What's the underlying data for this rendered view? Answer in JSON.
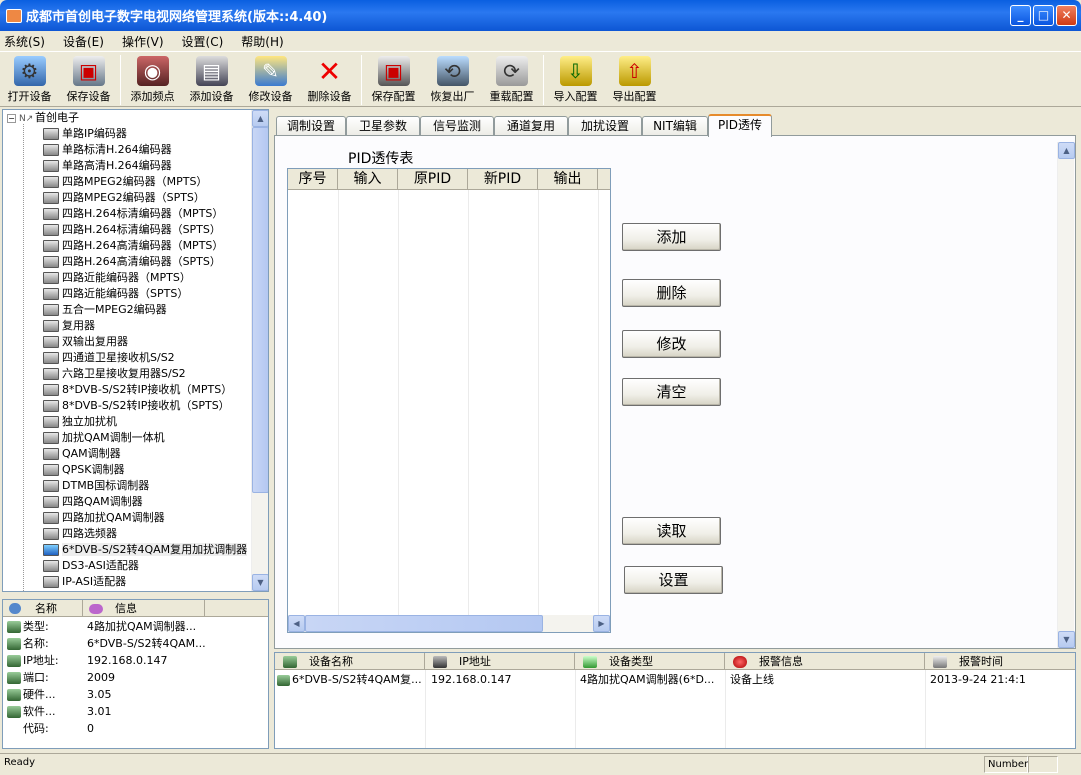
{
  "window": {
    "title": "成都市首创电子数字电视网络管理系统(版本::4.40)"
  },
  "menu": [
    "系统(S)",
    "设备(E)",
    "操作(V)",
    "设置(C)",
    "帮助(H)"
  ],
  "toolbar": [
    {
      "label": "打开设备",
      "icon": "open-device-icon"
    },
    {
      "label": "保存设备",
      "icon": "save-device-icon"
    },
    {
      "label": "添加频点",
      "icon": "add-frequency-icon"
    },
    {
      "label": "添加设备",
      "icon": "add-device-icon"
    },
    {
      "label": "修改设备",
      "icon": "edit-device-icon"
    },
    {
      "label": "删除设备",
      "icon": "delete-device-icon"
    },
    {
      "label": "保存配置",
      "icon": "save-config-icon"
    },
    {
      "label": "恢复出厂",
      "icon": "factory-reset-icon"
    },
    {
      "label": "重载配置",
      "icon": "reload-config-icon"
    },
    {
      "label": "导入配置",
      "icon": "import-config-icon"
    },
    {
      "label": "导出配置",
      "icon": "export-config-icon"
    }
  ],
  "tree": {
    "root": "首创电子",
    "items": [
      "单路IP编码器",
      "单路标清H.264编码器",
      "单路高清H.264编码器",
      "四路MPEG2编码器（MPTS）",
      "四路MPEG2编码器（SPTS）",
      "四路H.264标清编码器（MPTS）",
      "四路H.264标清编码器（SPTS）",
      "四路H.264高清编码器（MPTS）",
      "四路H.264高清编码器（SPTS）",
      "四路近能编码器（MPTS）",
      "四路近能编码器（SPTS）",
      "五合一MPEG2编码器",
      "复用器",
      "双输出复用器",
      "四通道卫星接收机S/S2",
      "六路卫星接收复用器S/S2",
      "8*DVB-S/S2转IP接收机（MPTS）",
      "8*DVB-S/S2转IP接收机（SPTS）",
      "独立加扰机",
      "加扰QAM调制一体机",
      "QAM调制器",
      "QPSK调制器",
      "DTMB国标调制器",
      "四路QAM调制器",
      "四路加扰QAM调制器",
      "四路选频器",
      "6*DVB-S/S2转4QAM复用加扰调制器",
      "DS3-ASI适配器",
      "IP-ASI适配器"
    ],
    "selected_index": 26
  },
  "info": {
    "col_name": "名称",
    "col_info": "信息",
    "rows": [
      {
        "key": "类型:",
        "value": "4路加扰QAM调制器..."
      },
      {
        "key": "名称:",
        "value": "6*DVB-S/S2转4QAM..."
      },
      {
        "key": "IP地址:",
        "value": "192.168.0.147"
      },
      {
        "key": "端口:",
        "value": "2009"
      },
      {
        "key": "硬件...",
        "value": "3.05"
      },
      {
        "key": "软件...",
        "value": "3.01"
      },
      {
        "key": "代码:",
        "value": "0"
      }
    ]
  },
  "tabs": [
    "调制设置",
    "卫星参数",
    "信号监测",
    "通道复用",
    "加扰设置",
    "NIT编辑",
    "PID透传"
  ],
  "active_tab": 6,
  "pid": {
    "title": "PID透传表",
    "columns": [
      "序号",
      "输入",
      "原PID",
      "新PID",
      "输出"
    ],
    "buttons": {
      "add": "添加",
      "delete": "删除",
      "modify": "修改",
      "clear": "清空",
      "read": "读取",
      "set": "设置"
    }
  },
  "alarm": {
    "columns": [
      "设备名称",
      "IP地址",
      "设备类型",
      "报警信息",
      "报警时间"
    ],
    "rows": [
      {
        "name": "6*DVB-S/S2转4QAM复...",
        "ip": "192.168.0.147",
        "type": "4路加扰QAM调制器(6*D...",
        "info": "设备上线",
        "time": "2013-9-24 21:4:1"
      }
    ]
  },
  "status": {
    "text": "Ready",
    "pane": "Number"
  }
}
